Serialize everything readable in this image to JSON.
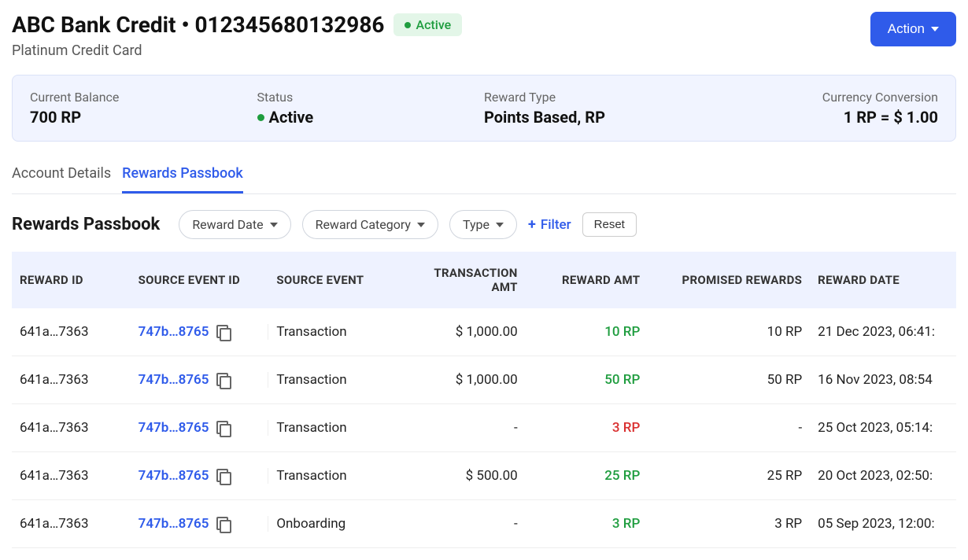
{
  "header": {
    "title": "ABC Bank Credit • 012345680132986",
    "badge": "Active",
    "subtitle": "Platinum Credit Card",
    "action_label": "Action"
  },
  "summary": {
    "balance_label": "Current Balance",
    "balance_value": "700 RP",
    "status_label": "Status",
    "status_value": "Active",
    "rewardtype_label": "Reward Type",
    "rewardtype_value": "Points Based, RP",
    "conversion_label": "Currency Conversion",
    "conversion_value": "1 RP  =  $ 1.00"
  },
  "tabs": {
    "details": "Account Details",
    "passbook": "Rewards Passbook"
  },
  "filters": {
    "section_title": "Rewards Passbook",
    "reward_date": "Reward Date",
    "reward_category": "Reward Category",
    "type": "Type",
    "filter": "Filter",
    "reset": "Reset"
  },
  "columns": {
    "reward_id": "REWARD ID",
    "source_event_id": "SOURCE EVENT ID",
    "source_event": "SOURCE EVENT",
    "transaction_amt": "TRANSACTION AMT",
    "reward_amt": "REWARD AMT",
    "promised_rewards": "PROMISED REWARDS",
    "reward_date": "REWARD DATE"
  },
  "rows": [
    {
      "reward_id": "641a…7363",
      "source_event_id": "747b…8765",
      "source_event": "Transaction",
      "transaction_amt": "$ 1,000.00",
      "reward_amt": "10 RP",
      "reward_amt_sign": "pos",
      "promised": "10 RP",
      "reward_date": "21 Dec 2023, 06:41:"
    },
    {
      "reward_id": "641a…7363",
      "source_event_id": "747b…8765",
      "source_event": "Transaction",
      "transaction_amt": "$ 1,000.00",
      "reward_amt": "50 RP",
      "reward_amt_sign": "pos",
      "promised": "50 RP",
      "reward_date": "16 Nov 2023, 08:54"
    },
    {
      "reward_id": "641a…7363",
      "source_event_id": "747b…8765",
      "source_event": "Transaction",
      "transaction_amt": "-",
      "reward_amt": "3 RP",
      "reward_amt_sign": "neg",
      "promised": "-",
      "reward_date": "25 Oct 2023, 05:14:"
    },
    {
      "reward_id": "641a…7363",
      "source_event_id": "747b…8765",
      "source_event": "Transaction",
      "transaction_amt": "$ 500.00",
      "reward_amt": "25 RP",
      "reward_amt_sign": "pos",
      "promised": "25 RP",
      "reward_date": "20 Oct 2023, 02:50:"
    },
    {
      "reward_id": "641a…7363",
      "source_event_id": "747b…8765",
      "source_event": "Onboarding",
      "transaction_amt": "-",
      "reward_amt": "3 RP",
      "reward_amt_sign": "pos",
      "promised": "3 RP",
      "reward_date": "05 Sep 2023, 12:00:"
    }
  ]
}
